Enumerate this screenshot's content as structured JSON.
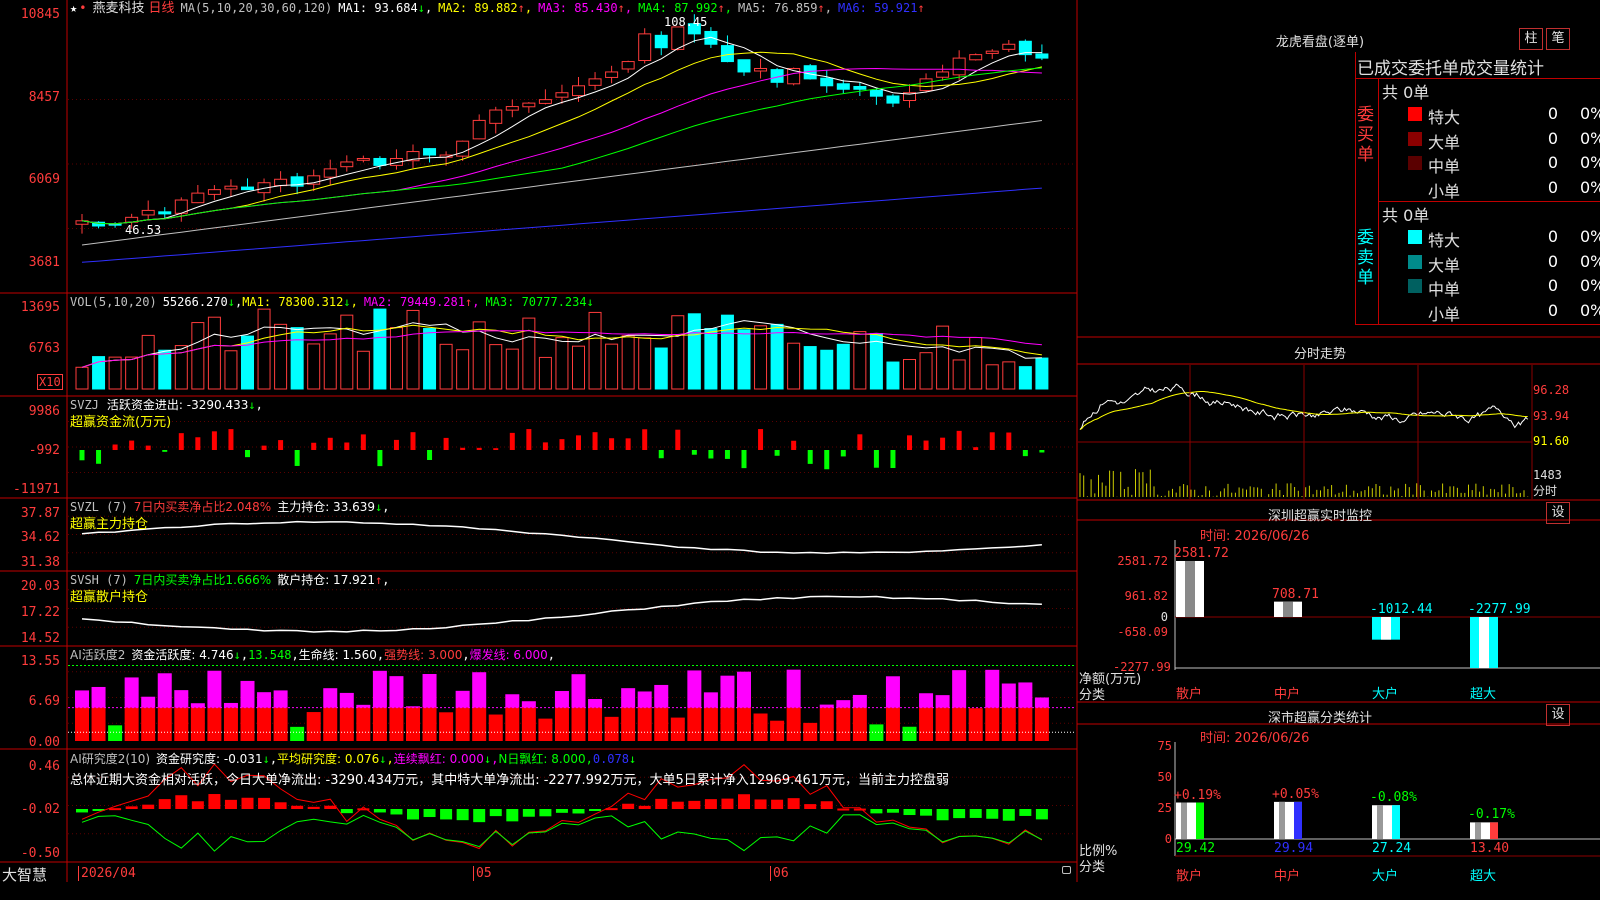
{
  "stock": {
    "star": "★",
    "dots": "•",
    "name": "燕麦科技",
    "period": "日线"
  },
  "colors": {
    "up": "#ff3c3c",
    "down": "#00ffff",
    "ma1": "#ffffff",
    "ma2": "#ffff00",
    "ma3": "#ff00ff",
    "ma4": "#00ff00",
    "ma5": "#c0c0c0",
    "ma6": "#3030ff",
    "grid": "#8b0000",
    "frame": "#c00000"
  },
  "main_panel": {
    "ma_header": "MA(5,10,20,30,60,120)",
    "ma": [
      {
        "label": "MA1: 93.684",
        "arrow": "↓"
      },
      {
        "label": "MA2: 89.882",
        "arrow": "↑"
      },
      {
        "label": "MA3: 85.430",
        "arrow": "↑"
      },
      {
        "label": "MA4: 87.992",
        "arrow": "↑"
      },
      {
        "label": "MA5: 76.859",
        "arrow": "↑"
      },
      {
        "label": "MA6: 59.921",
        "arrow": "↑"
      }
    ],
    "y_ticks": [
      "10845",
      "8457",
      "6069",
      "3681"
    ],
    "high_label": "108.45",
    "low_label": "46.53"
  },
  "vol_panel": {
    "header": "VOL(5,10,20)",
    "value": "55266.270",
    "value_arrow": "↓",
    "ma": [
      {
        "label": "MA1: 78300.312",
        "arrow": "↓"
      },
      {
        "label": "MA2: 79449.281",
        "arrow": "↑"
      },
      {
        "label": "MA3: 70777.234",
        "arrow": "↓"
      }
    ],
    "y_ticks": [
      "13695",
      "6763"
    ],
    "unit": "X10"
  },
  "svzj_panel": {
    "header": "SVZJ",
    "label": "活跃资金进出: -3290.433",
    "arrow": "↓",
    "trail": ",",
    "title": "超赢资金流(万元)",
    "y_ticks": [
      "9986",
      "-992",
      "-11971"
    ]
  },
  "svzl_panel": {
    "header": "SVZL (7)",
    "label": "7日内买卖净占比2.048%",
    "label2": "主力持仓: 33.639",
    "arrow": "↓",
    "trail": ",",
    "title": "超赢主力持仓",
    "y_ticks": [
      "37.87",
      "34.62",
      "31.38"
    ]
  },
  "svsh_panel": {
    "header": "SVSH (7)",
    "label": "7日内买卖净占比1.666%",
    "label2": "散户持仓: 17.921",
    "arrow": "↑",
    "trail": ",",
    "title": "超赢散户持仓",
    "y_ticks": [
      "20.03",
      "17.22",
      "14.52"
    ]
  },
  "ai1_panel": {
    "header": "AI活跃度2",
    "label": "资金活跃度: 4.746",
    "arrow": "↓",
    "v2": "13.548",
    "v3": "生命线: 1.560",
    "v4": "强势线: 3.000",
    "v5": "爆发线: 6.000",
    "trail": ",",
    "y_ticks": [
      "13.55",
      "6.69",
      "0.00"
    ]
  },
  "ai2_panel": {
    "header": "AI研究度2(10)",
    "label": "资金研究度: -0.031",
    "arrow": "↓",
    "v2": "平均研究度: 0.076",
    "arrow2": "↓",
    "v3": "连续飘红: 0.000",
    "arrow3": "↓",
    "v4": "N日飘红: 8.000",
    "v5": "0.078",
    "arrow5": "↓",
    "summary": "总体近期大资金相对活跃，今日大单净流出: -3290.434万元，其中特大单净流出: -2277.992万元，大单5日累计净入12969.461万元，当前主力控盘弱",
    "y_ticks": [
      "0.46",
      "-0.02",
      "-0.50"
    ]
  },
  "x_axis": {
    "brand": "大智慧",
    "labels": [
      "2026/04",
      "05",
      "06"
    ]
  },
  "right": {
    "dragon": {
      "title": "龙虎看盘(逐单)",
      "btn1": "柱",
      "btn2": "笔",
      "subtitle": "已成交委托单成交量统计",
      "buy": {
        "side_label": "委买单",
        "total": "共 0单",
        "rows": [
          {
            "name": "特大",
            "value": "0",
            "pct": "0%",
            "color": "#ff0000"
          },
          {
            "name": "大单",
            "value": "0",
            "pct": "0%",
            "color": "#8b0000"
          },
          {
            "name": "中单",
            "value": "0",
            "pct": "0%",
            "color": "#5a0000"
          },
          {
            "name": "小单",
            "value": "0",
            "pct": "0%",
            "color": "#000000"
          }
        ]
      },
      "sell": {
        "side_label": "委卖单",
        "total": "共 0单",
        "rows": [
          {
            "name": "特大",
            "value": "0",
            "pct": "0%",
            "color": "#00ffff"
          },
          {
            "name": "大单",
            "value": "0",
            "pct": "0%",
            "color": "#008b8b"
          },
          {
            "name": "中单",
            "value": "0",
            "pct": "0%",
            "color": "#006060"
          },
          {
            "name": "小单",
            "value": "0",
            "pct": "0%",
            "color": "#000000"
          }
        ]
      }
    },
    "intraday": {
      "title": "分时走势",
      "prices": [
        "96.28",
        "93.94",
        "91.60"
      ],
      "vol": "1483",
      "vol_unit": "分时"
    },
    "monitor": {
      "title": "深圳超赢实时监控",
      "btn": "设",
      "date": "时间: 2026/06/26",
      "y_ticks": [
        "2581.72",
        "961.82",
        "0",
        "-658.09",
        "-2277.99"
      ],
      "y_label1": "净额(万元)",
      "y_label2": "分类",
      "bars": [
        {
          "cat": "散户",
          "value": 2581.72,
          "label": "2581.72"
        },
        {
          "cat": "中户",
          "value": 708.71,
          "label": "708.71"
        },
        {
          "cat": "大户",
          "value": -1012.44,
          "label": "-1012.44"
        },
        {
          "cat": "超大",
          "value": -2277.99,
          "label": "-2277.99"
        }
      ]
    },
    "classify": {
      "title": "深市超赢分类统计",
      "btn": "设",
      "date": "时间: 2026/06/26",
      "y_ticks": [
        "75",
        "50",
        "25",
        "0"
      ],
      "y_label1": "比例%",
      "y_label2": "分类",
      "bars": [
        {
          "cat": "散户",
          "value": 29.42,
          "change": "+0.19%",
          "color": "#00ff00"
        },
        {
          "cat": "中户",
          "value": 29.94,
          "change": "+0.05%",
          "color": "#3030ff"
        },
        {
          "cat": "大户",
          "value": 27.24,
          "change": "-0.08%",
          "color": "#00ffff"
        },
        {
          "cat": "超大",
          "value": 13.4,
          "change": "-0.17%",
          "color": "#ff3c3c"
        }
      ],
      "value_labels": [
        "29.42",
        "29.94",
        "27.24",
        "13.40"
      ]
    }
  }
}
